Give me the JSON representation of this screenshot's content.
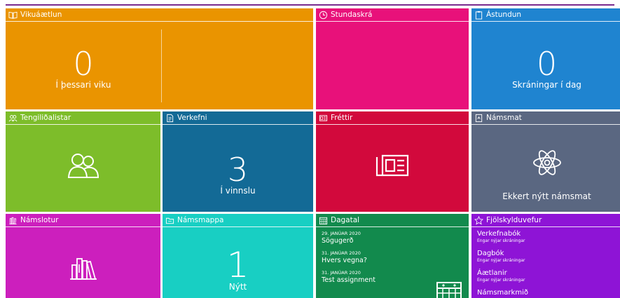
{
  "tiles": {
    "vikuaaetlun": {
      "title": "Vikuáætlun",
      "count": "0",
      "caption": "Í þessari viku",
      "color": "#ea9400"
    },
    "stundaskra": {
      "title": "Stundaskrá",
      "color": "#e8117a"
    },
    "astundun": {
      "title": "Ástundun",
      "count": "0",
      "caption": "Skráningar í dag",
      "color": "#1f84d0"
    },
    "tengilidalistar": {
      "title": "Tengiliðalistar",
      "icon": "people-icon",
      "color": "#7dbd2a"
    },
    "verkefni": {
      "title": "Verkefni",
      "count": "3",
      "caption": "Í vinnslu",
      "color": "#136a96"
    },
    "frettir": {
      "title": "Fréttir",
      "icon": "newspaper-icon",
      "color": "#d2093c"
    },
    "namsmat": {
      "title": "Námsmat",
      "caption": "Ekkert nýtt námsmat",
      "icon": "atom-icon",
      "color": "#5a6781"
    },
    "namslotur": {
      "title": "Námslotur",
      "icon": "books-icon",
      "color": "#cc1fbd"
    },
    "namsmappa": {
      "title": "Námsmappa",
      "count": "1",
      "caption": "Nýtt",
      "color": "#18cfc3"
    },
    "dagatal": {
      "title": "Dagatal",
      "color": "#128a4d",
      "events": [
        {
          "date": "29. JANÚAR 2020",
          "title": "Sögugerð"
        },
        {
          "date": "31. JANÚAR 2020",
          "title": "Hvers vegna?"
        },
        {
          "date": "31. JANÚAR 2020",
          "title": "Test assignment"
        }
      ]
    },
    "fjolskylduvefur": {
      "title": "Fjölskylduvefur",
      "color": "#8e14d6",
      "items": [
        {
          "name": "Verkefnabók",
          "status": "Engar nýjar skráningar"
        },
        {
          "name": "Dagbók",
          "status": "Engar nýjar skráningar"
        },
        {
          "name": "Áætlanir",
          "status": "Engar nýjar skráningar"
        },
        {
          "name": "Námsmarkmið",
          "status": ""
        }
      ]
    }
  }
}
